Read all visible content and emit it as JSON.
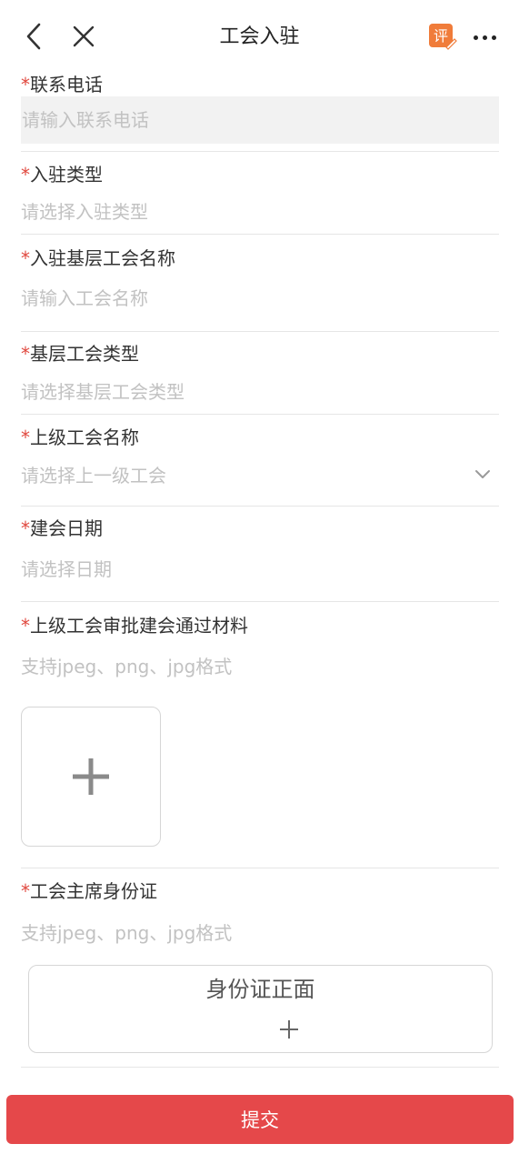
{
  "nav": {
    "title": "工会入驻",
    "review_badge": "评"
  },
  "form": {
    "phone": {
      "required_mark": "*",
      "label": "联系电话",
      "placeholder": "请输入联系电话"
    },
    "settle_type": {
      "required_mark": "*",
      "label": "入驻类型",
      "placeholder": "请选择入驻类型"
    },
    "union_name": {
      "required_mark": "*",
      "label": "入驻基层工会名称",
      "placeholder": "请输入工会名称"
    },
    "union_type": {
      "required_mark": "*",
      "label": "基层工会类型",
      "placeholder": "请选择基层工会类型"
    },
    "parent_union": {
      "required_mark": "*",
      "label": "上级工会名称",
      "placeholder": "请选择上一级工会"
    },
    "founding_date": {
      "required_mark": "*",
      "label": "建会日期",
      "placeholder": "请选择日期"
    },
    "approval_material": {
      "required_mark": "*",
      "label": "上级工会审批建会通过材料",
      "hint": "支持jpeg、png、jpg格式"
    },
    "chairman_id": {
      "required_mark": "*",
      "label": "工会主席身份证",
      "hint": "支持jpeg、png、jpg格式",
      "front_label": "身份证正面"
    }
  },
  "submit_label": "提交",
  "colors": {
    "required": "#e0483e",
    "submit_bg": "#e5484a",
    "placeholder": "#c2c2c2",
    "review_badge": "#f07c3a"
  }
}
